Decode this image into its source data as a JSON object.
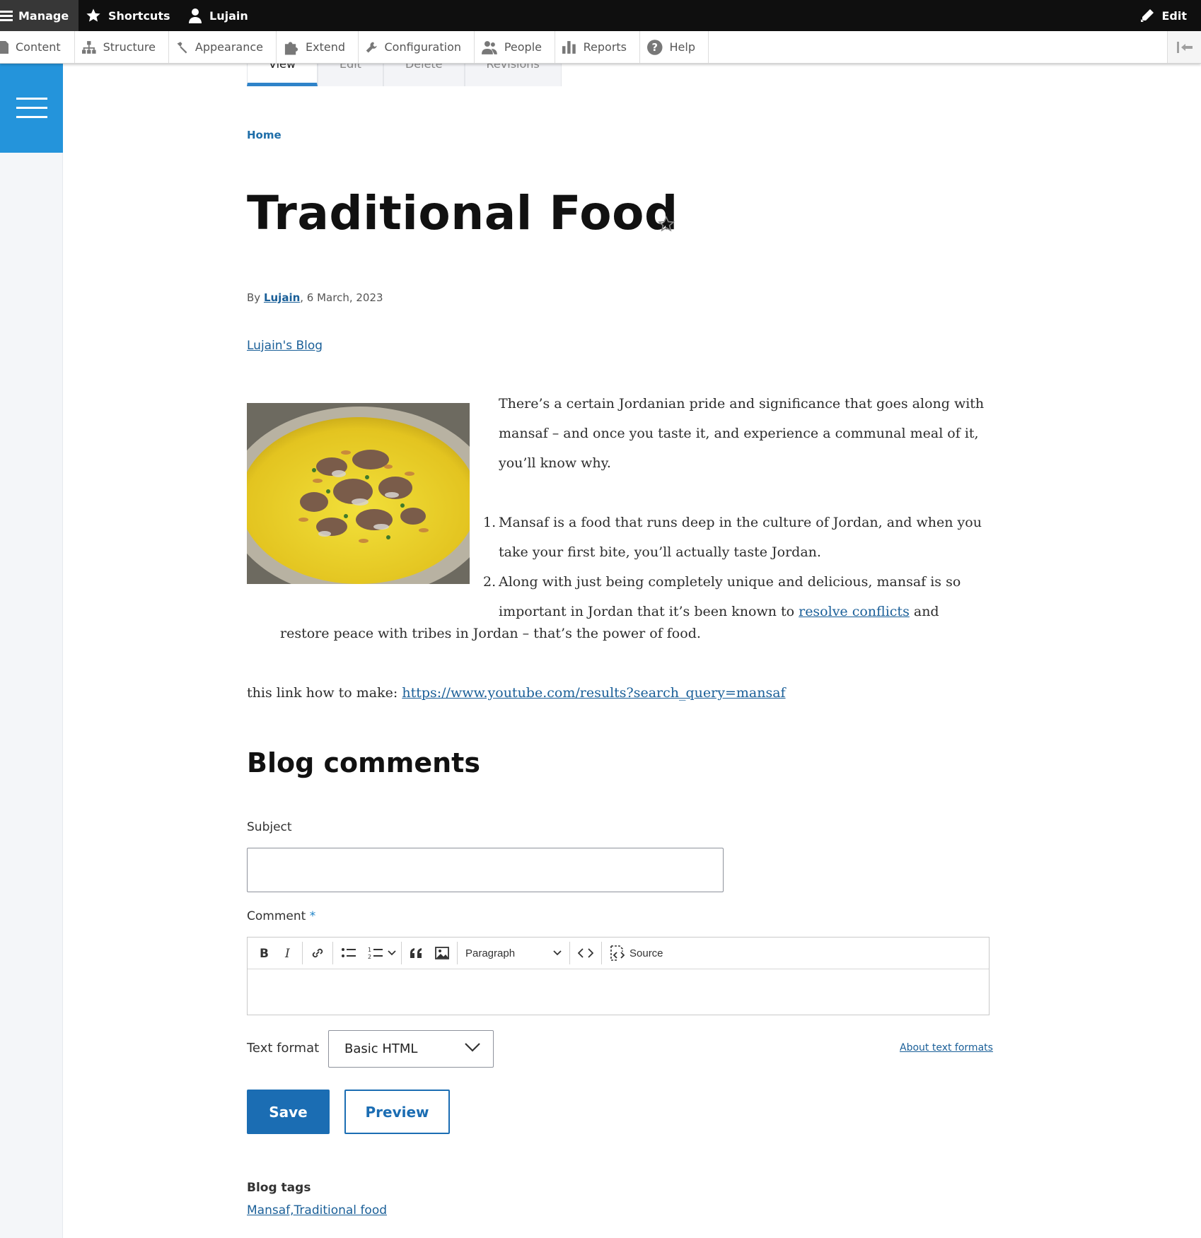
{
  "toolbar": {
    "manage_label": "Manage",
    "shortcuts_label": "Shortcuts",
    "user_label": "Lujain",
    "edit_label": "Edit"
  },
  "tray": {
    "items": [
      {
        "label": "Content",
        "icon": "file-icon"
      },
      {
        "label": "Structure",
        "icon": "sitemap-icon"
      },
      {
        "label": "Appearance",
        "icon": "paintbrush-icon"
      },
      {
        "label": "Extend",
        "icon": "puzzle-icon"
      },
      {
        "label": "Configuration",
        "icon": "wrench-icon"
      },
      {
        "label": "People",
        "icon": "people-icon"
      },
      {
        "label": "Reports",
        "icon": "bar-chart-icon"
      },
      {
        "label": "Help",
        "icon": "help-icon"
      }
    ]
  },
  "tabs": [
    "View",
    "Edit",
    "Delete",
    "Revisions"
  ],
  "breadcrumb": {
    "home": "Home"
  },
  "page": {
    "title": "Traditional Food",
    "byline_prefix": "By ",
    "author": "Lujain",
    "date": ", 6 March, 2023",
    "blog_link": "Lujain's Blog"
  },
  "article": {
    "intro": "There’s a certain Jordanian pride and significance that goes along with mansaf – and once you taste it, and experience a communal meal of it, you’ll know why.",
    "list": [
      {
        "num": "1.",
        "text": "Mansaf is a food that runs deep in the culture of Jordan, and when you take your first bite, you’ll actually taste Jordan."
      },
      {
        "num": "2.",
        "text_before": "Along with just being completely unique and delicious, mansaf is so important in Jordan that it’s been known to ",
        "link": "resolve conflicts",
        "text_after": " and"
      }
    ],
    "list_tail": "restore peace with tribes in Jordan – that’s the power of food.",
    "howto_prefix": "this link how to make: ",
    "howto_link": "https://www.youtube.com/results?search_query=mansaf"
  },
  "comments": {
    "heading": "Blog comments",
    "subject_label": "Subject",
    "subject_value": "",
    "comment_label": "Comment",
    "required_mark": "*",
    "editor": {
      "paragraph": "Paragraph",
      "source": "Source"
    },
    "text_format_label": "Text format",
    "text_format_value": "Basic HTML",
    "about_formats": "About text formats",
    "save": "Save",
    "preview": "Preview"
  },
  "tags": {
    "label": "Blog tags",
    "value": "Mansaf,Traditional food"
  },
  "colors": {
    "accent": "#2494db",
    "primary_button": "#1b6db3",
    "link": "#1a5f98"
  }
}
